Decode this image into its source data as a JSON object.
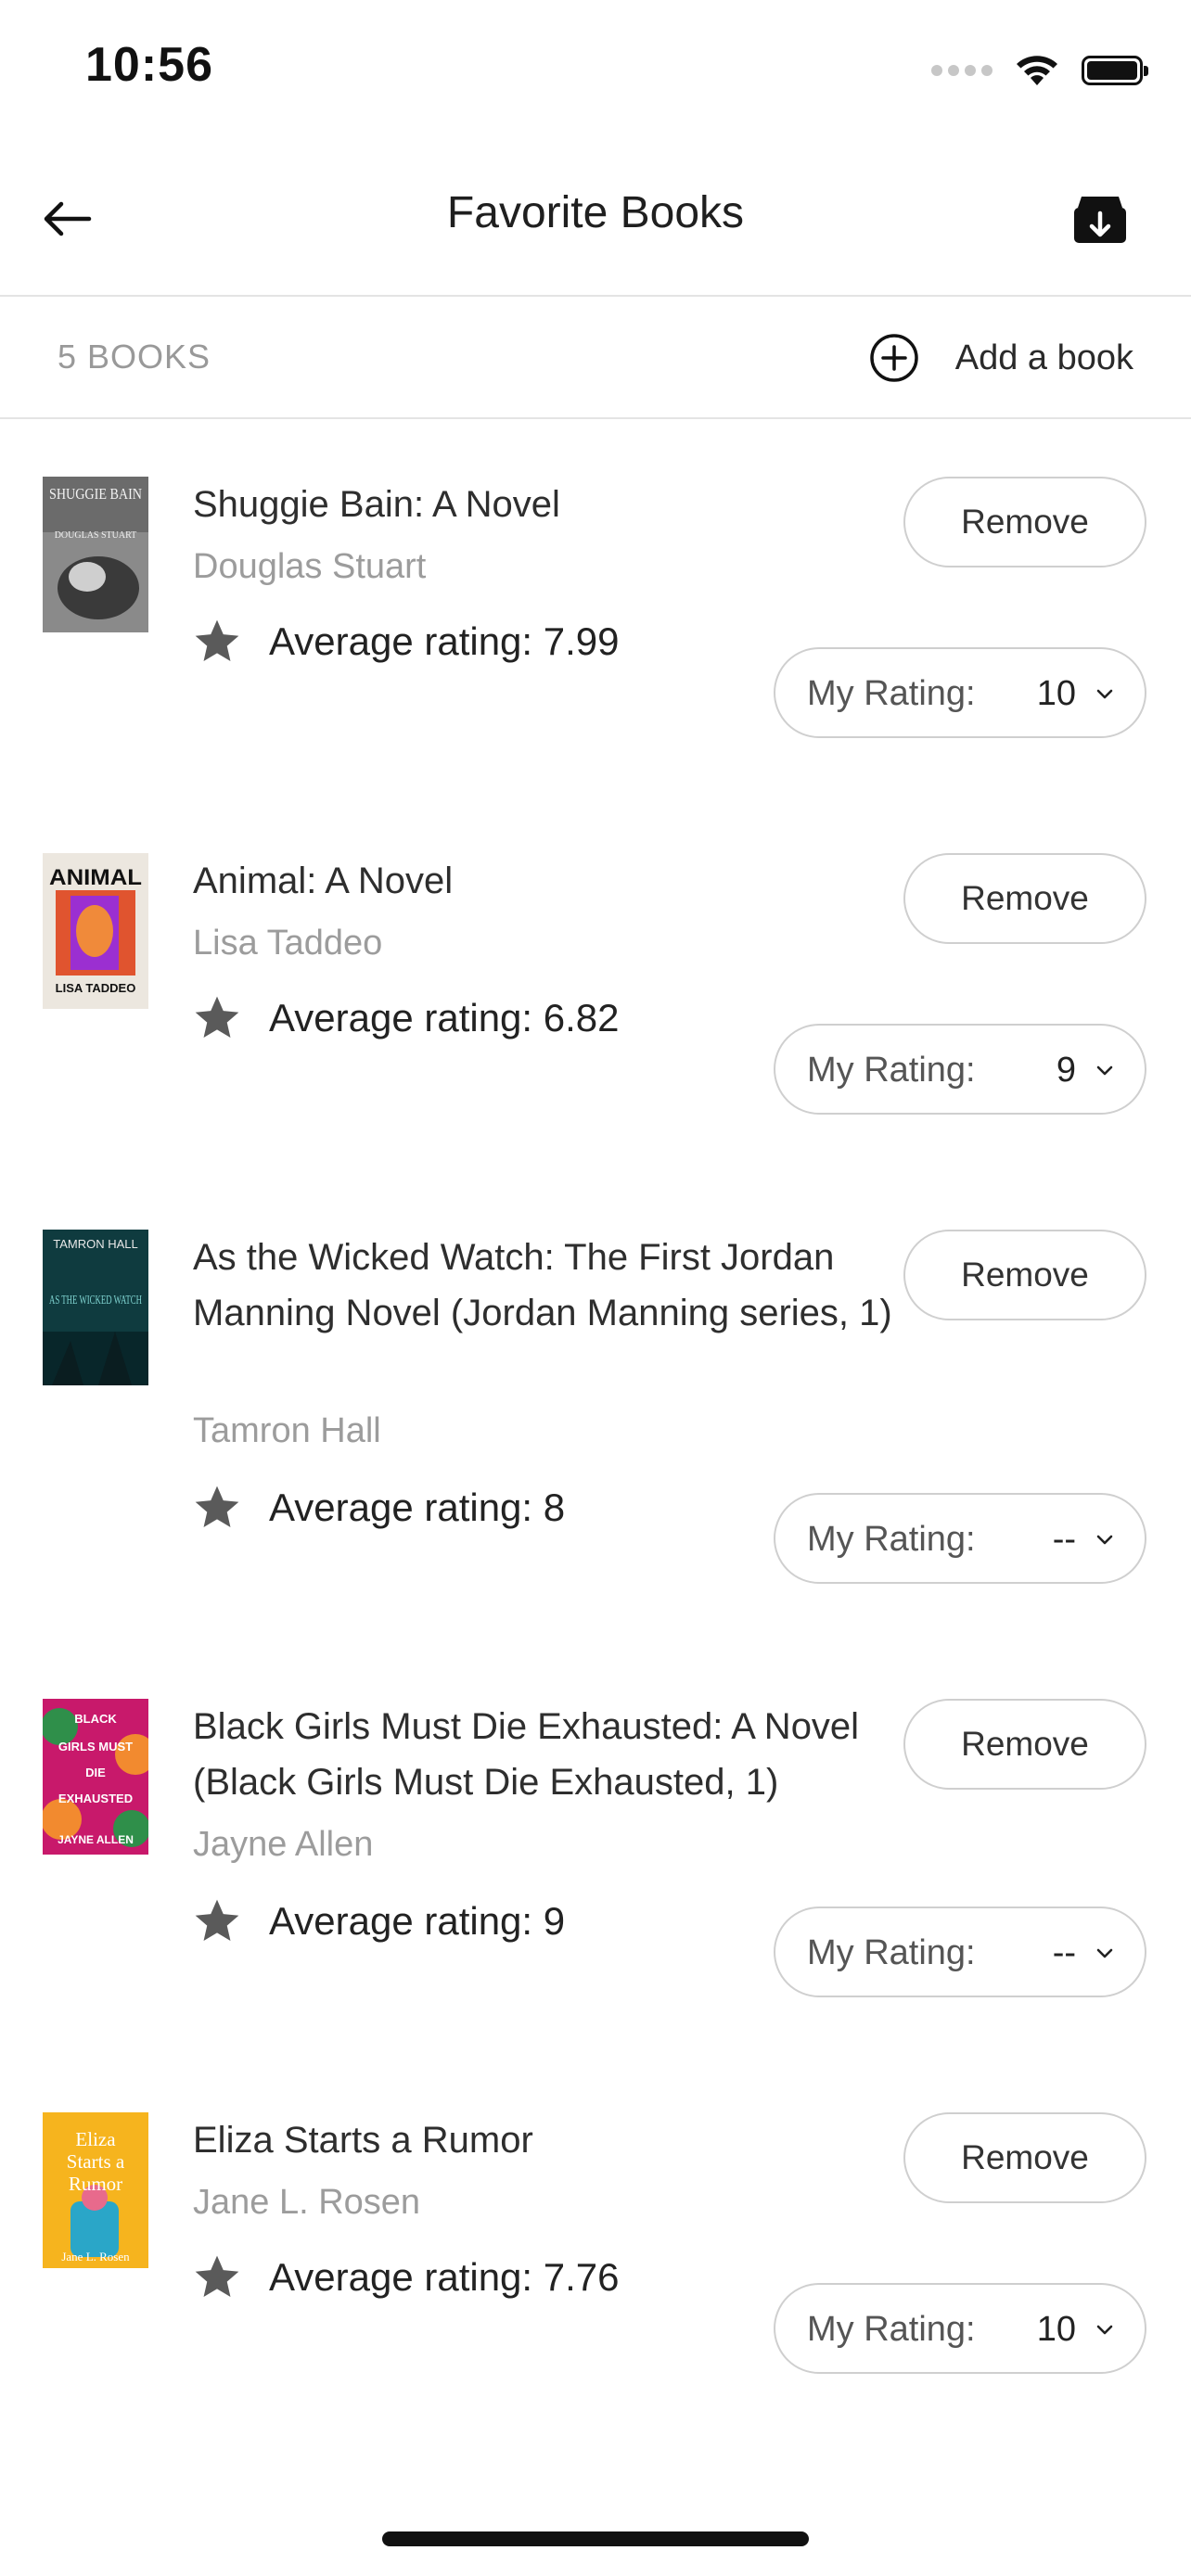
{
  "status_bar": {
    "time": "10:56"
  },
  "nav": {
    "title": "Favorite Books",
    "back_icon": "arrow-left-icon",
    "export_icon": "download-tray-icon"
  },
  "subheader": {
    "count_label": "5 BOOKS",
    "add_label": "Add a book",
    "add_icon": "plus-circle-icon"
  },
  "books": [
    {
      "title": "Shuggie Bain: A Novel",
      "author": "Douglas Stuart",
      "remove_label": "Remove",
      "avg_rating_text": "Average rating: 7.99",
      "my_rating_label": "My Rating:",
      "my_rating_value": "10",
      "cover": {
        "top_text": "SHUGGIE BAIN",
        "bottom_text": "DOUGLAS STUART",
        "bg": "#6e6e6e",
        "accent": "#e8e8e8"
      }
    },
    {
      "title": "Animal: A Novel",
      "author": "Lisa Taddeo",
      "remove_label": "Remove",
      "avg_rating_text": "Average rating: 6.82",
      "my_rating_label": "My Rating:",
      "my_rating_value": "9",
      "cover": {
        "top_text": "ANIMAL",
        "bottom_text": "LISA TADDEO",
        "bg": "#ece7df",
        "accent": "#e0542f"
      }
    },
    {
      "title": "As the Wicked Watch: The First Jordan Manning Novel (Jordan Manning series, 1)",
      "author": "Tamron Hall",
      "remove_label": "Remove",
      "avg_rating_text": "Average rating: 8",
      "my_rating_label": "My Rating:",
      "my_rating_value": "--",
      "cover": {
        "top_text": "TAMRON HALL",
        "bottom_text": "AS THE WICKED WATCH",
        "bg": "#0f3b3f",
        "accent": "#7fd3d0"
      }
    },
    {
      "title": "Black Girls Must Die Exhausted: A Novel (Black Girls Must Die Exhausted, 1)",
      "author": "Jayne Allen",
      "remove_label": "Remove",
      "avg_rating_text": "Average rating: 9",
      "my_rating_label": "My Rating:",
      "my_rating_value": "--",
      "cover": {
        "top_text": "BLACK GIRLS MUST DIE EXHAUSTED",
        "bottom_text": "JAYNE ALLEN",
        "bg": "#c8196b",
        "accent": "#2f8f4a"
      }
    },
    {
      "title": "Eliza Starts a Rumor",
      "author": "Jane L. Rosen",
      "remove_label": "Remove",
      "avg_rating_text": "Average rating: 7.76",
      "my_rating_label": "My Rating:",
      "my_rating_value": "10",
      "cover": {
        "top_text": "Eliza Starts a Rumor",
        "bottom_text": "Jane L. Rosen",
        "bg": "#f6b41e",
        "accent": "#2aa6c8"
      }
    }
  ]
}
